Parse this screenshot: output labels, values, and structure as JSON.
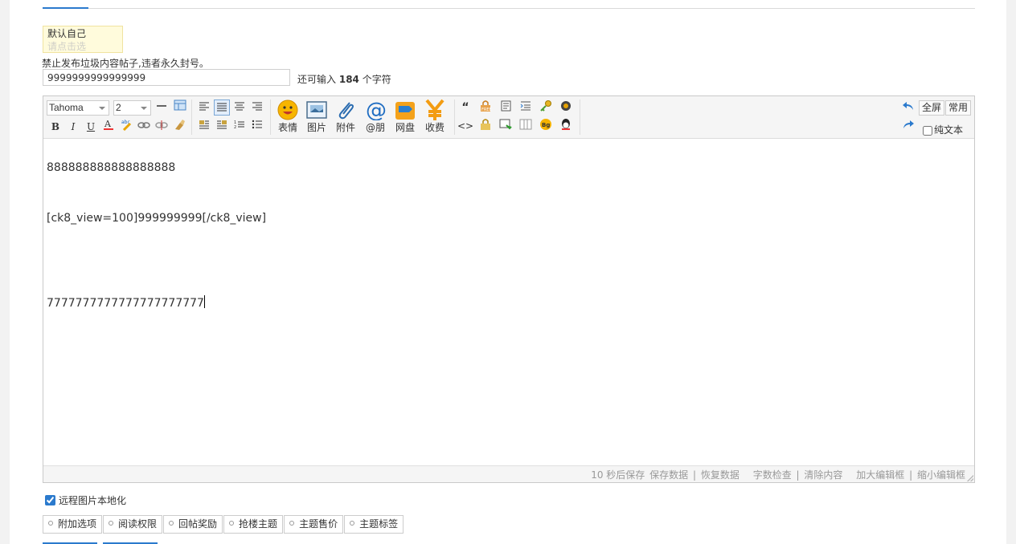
{
  "sticky": {
    "line1": "默认自己",
    "line2": "请点击选"
  },
  "notice": "禁止发布垃圾内容帖子,违者永久封号。",
  "subject": {
    "value": "9999999999999999",
    "remain_prefix": "还可输入",
    "remain_count": "184",
    "remain_suffix": "个字符"
  },
  "toolbar": {
    "font": "Tahoma",
    "size": "2",
    "big_buttons": [
      "表情",
      "图片",
      "附件",
      "@朋",
      "网盘",
      "收费"
    ],
    "fullscreen": "全屏",
    "common": "常用",
    "plain_text": "纯文本"
  },
  "content": {
    "line1": "888888888888888888",
    "line2": "[ck8_view=100]999999999[/ck8_view]",
    "line3": "7777777777777777777777"
  },
  "statusbar": {
    "autosave": "10 秒后保存",
    "save": "保存数据",
    "restore": "恢复数据",
    "count": "字数检查",
    "clear": "清除内容",
    "enlarge": "加大编辑框",
    "shrink": "缩小编辑框"
  },
  "remote_image": "远程图片本地化",
  "tabs": [
    "附加选项",
    "阅读权限",
    "回帖奖励",
    "抢楼主题",
    "主题售价",
    "主题标签"
  ],
  "colors": {
    "accent": "#2b7acd",
    "sticky_bg": "#fffbdc"
  }
}
